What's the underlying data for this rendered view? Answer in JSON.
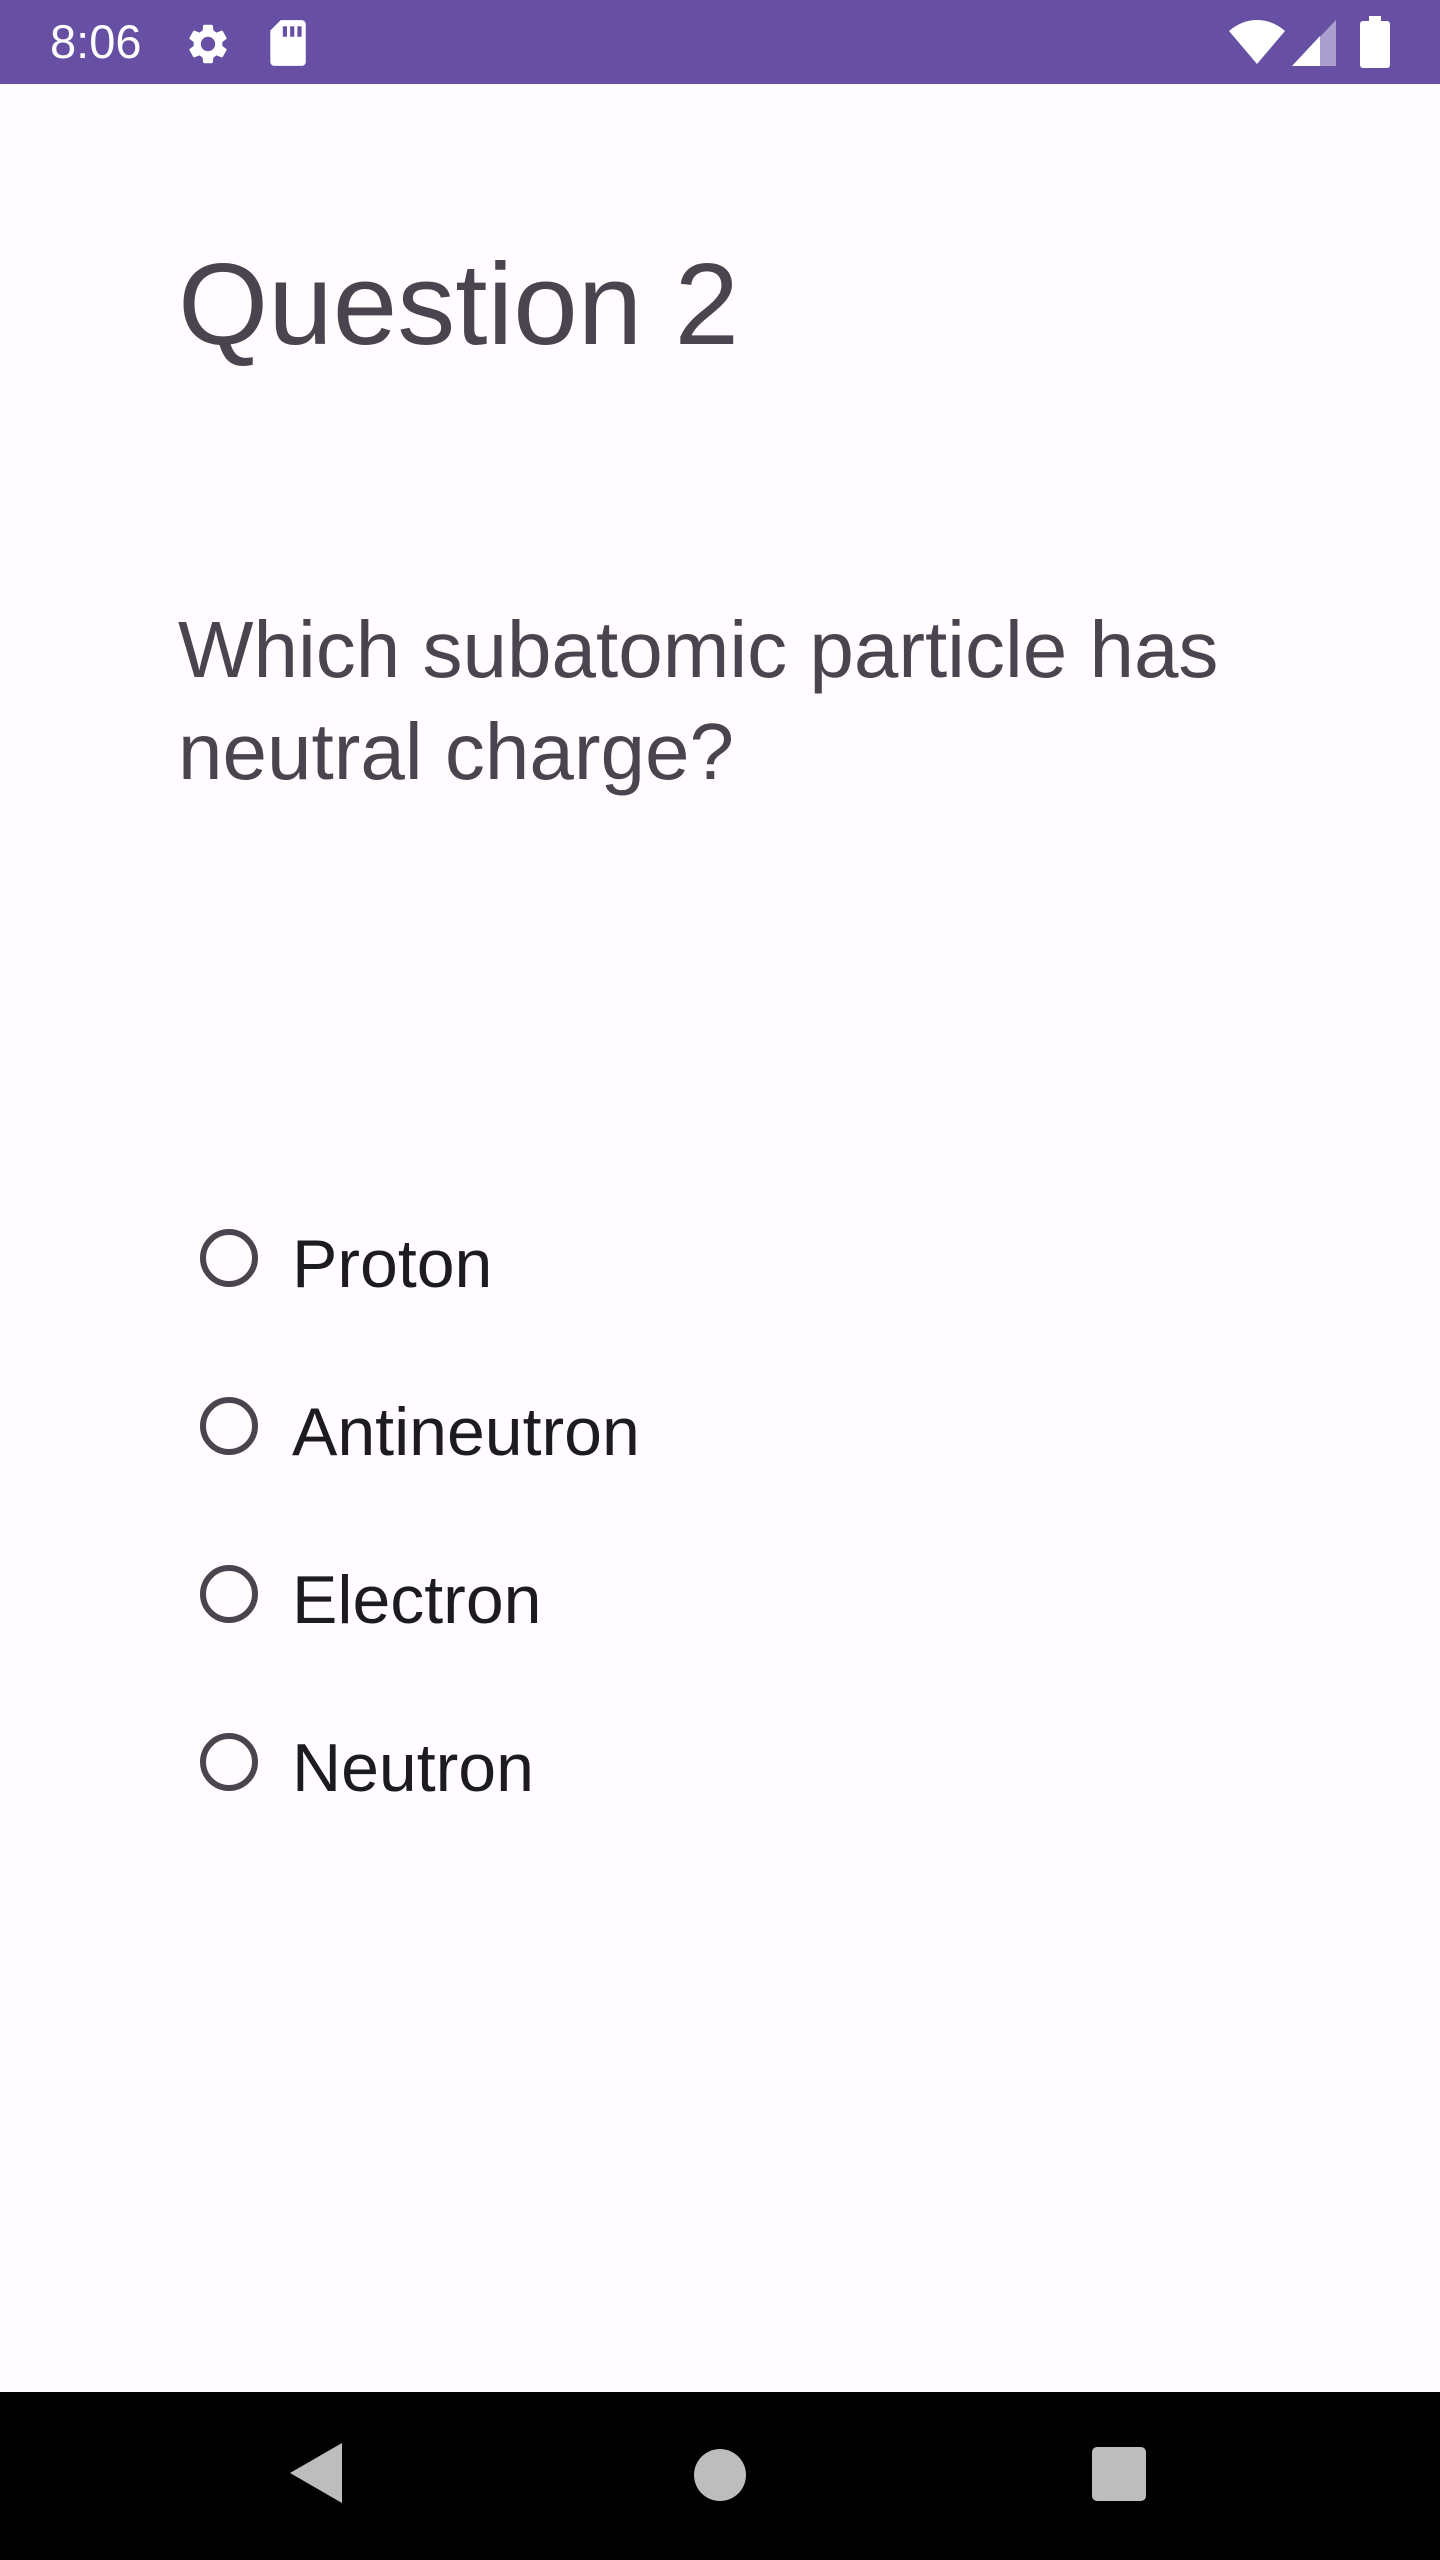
{
  "status_bar": {
    "time": "8:06",
    "icons": [
      "settings-icon",
      "sd-card-icon",
      "wifi-icon",
      "cellular-signal-icon",
      "battery-icon"
    ],
    "background": "#6750a4"
  },
  "quiz": {
    "title": "Question 2",
    "question": "Which subatomic particle has neutral charge?",
    "options": [
      {
        "label": "Proton",
        "selected": false
      },
      {
        "label": "Antineutron",
        "selected": false
      },
      {
        "label": "Electron",
        "selected": false
      },
      {
        "label": "Neutron",
        "selected": false
      }
    ]
  },
  "nav_bar": {
    "buttons": [
      "back-icon",
      "home-icon",
      "recents-icon"
    ]
  },
  "colors": {
    "accent": "#6750a4",
    "background": "#fffbfe",
    "text_secondary": "#49454f",
    "text_primary": "#1c1b1f"
  }
}
